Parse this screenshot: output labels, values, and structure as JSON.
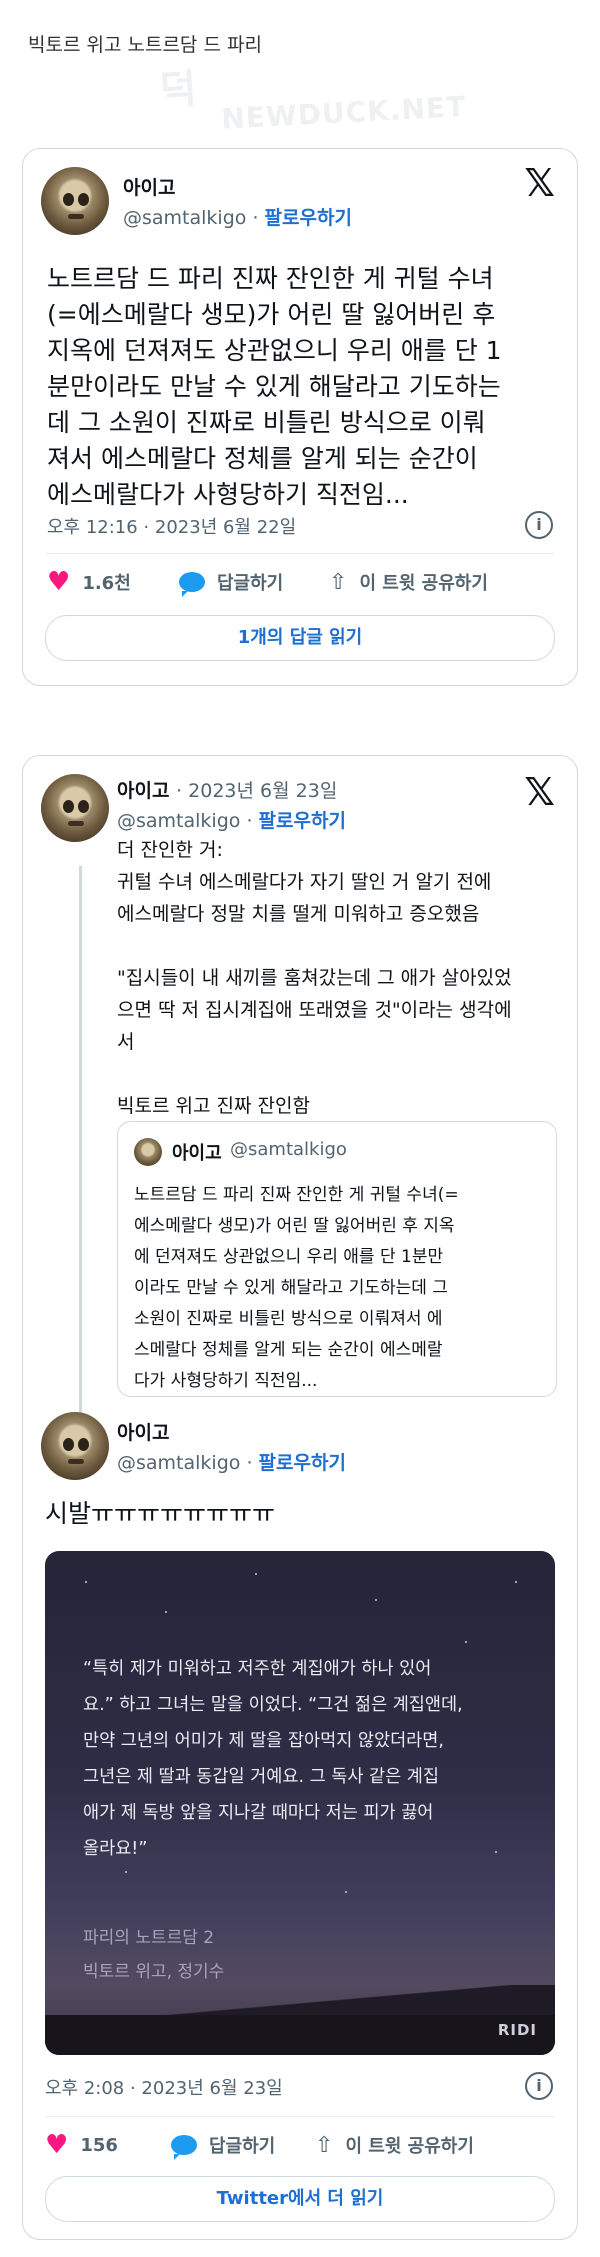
{
  "header": {
    "title": "빅토르 위고 노트르담 드 파리"
  },
  "watermark": {
    "line1": "덕",
    "line2": "NEWDUCK.NET"
  },
  "tweet1": {
    "name": "아이고",
    "handle": "@samtalkigo",
    "separator": "·",
    "follow": "팔로우하기",
    "x_logo": "𝕏",
    "text": "노트르담 드 파리 진짜 잔인한 게 귀털 수녀\n(=에스메랄다 생모)가 어린 딸 잃어버린 후\n지옥에 던져져도 상관없으니 우리 애를 단 1\n분만이라도 만날 수 있게 해달라고 기도하는\n데 그 소원이 진짜로 비틀린 방식으로 이뤄\n져서 에스메랄다 정체를 알게 되는 순간이\n에스메랄다가 사형당하기 직전임...",
    "timestamp": "오후 12:16 · 2023년 6월 22일",
    "likes": "1.6천",
    "reply_label": "답글하기",
    "share_label": "이 트윗 공유하기",
    "read_replies": "1개의 답글 읽기"
  },
  "tweet2": {
    "name": "아이고",
    "date": "· 2023년 6월 23일",
    "handle": "@samtalkigo",
    "separator": "·",
    "follow": "팔로우하기",
    "x_logo": "𝕏",
    "text": "더 잔인한 거:\n귀털 수녀 에스메랄다가 자기 딸인 거 알기 전에\n에스메랄다 정말 치를 떨게 미워하고 증오했음\n\n\"집시들이 내 새끼를 훔쳐갔는데 그 애가 살아있었\n으면 딱 저 집시계집애 또래였을 것\"이라는 생각에\n서\n\n빅토르 위고 진짜 잔인함",
    "quote": {
      "name": "아이고",
      "handle": "@samtalkigo",
      "text": "노트르담 드 파리 진짜 잔인한 게 귀털 수녀(=\n에스메랄다 생모)가 어린 딸 잃어버린 후 지옥\n에 던져져도 상관없으니 우리 애를 단 1분만\n이라도 만날 수 있게 해달라고 기도하는데 그\n소원이 진짜로 비틀린 방식으로 이뤄져서 에\n스메랄다 정체를 알게 되는 순간이 에스메랄\n다가 사형당하기 직전임..."
    }
  },
  "tweet3": {
    "name": "아이고",
    "handle": "@samtalkigo",
    "separator": "·",
    "follow": "팔로우하기",
    "text": "시발ㅠㅠㅠㅠㅠㅠㅠㅠ",
    "media": {
      "quote": "“특히 제가 미워하고 저주한 계집애가 하나 있어\n요.” 하고 그녀는 말을 이었다. “그건 젊은 계집앤데,\n만약 그년의 어미가 제 딸을 잡아먹지 않았더라면,\n그년은 제 딸과 동갑일 거예요. 그 독사 같은 계집\n애가 제 독방 앞을 지나갈 때마다 저는 피가 끓어\n올라요!”",
      "book_title": "파리의 노트르담 2",
      "book_author": "빅토르 위고, 정기수",
      "brand": "RIDI"
    },
    "timestamp": "오후 2:08 · 2023년 6월 23일",
    "likes": "156",
    "reply_label": "답글하기",
    "share_label": "이 트윗 공유하기",
    "read_more": "Twitter에서 더 읽기"
  },
  "icons": {
    "info": "i",
    "heart": "♥",
    "share": "⇧"
  }
}
